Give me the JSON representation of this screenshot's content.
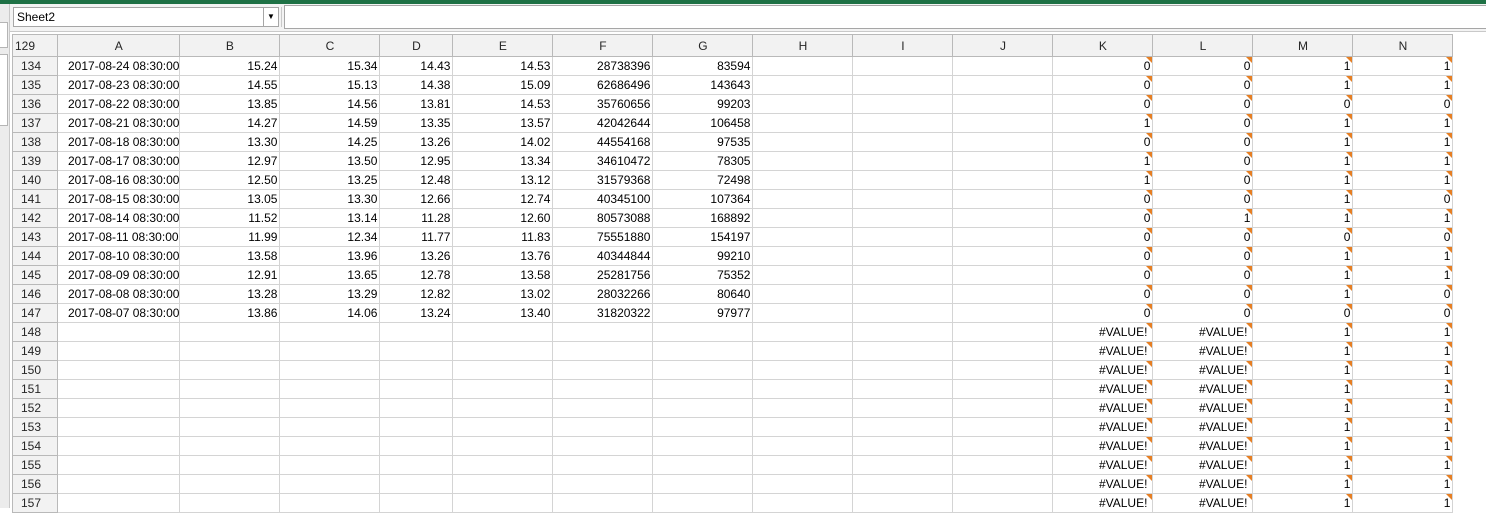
{
  "name_box": {
    "value": "Sheet2"
  },
  "formula_bar": {
    "value": ""
  },
  "corner_label": "129",
  "columns": [
    "A",
    "B",
    "C",
    "D",
    "E",
    "F",
    "G",
    "H",
    "I",
    "J",
    "K",
    "L",
    "M",
    "N"
  ],
  "rows": [
    {
      "num": "134",
      "A": "2017-08-24  08:30:00",
      "B": "15.24",
      "C": "15.34",
      "D": "14.43",
      "E": "14.53",
      "F": "28738396",
      "G": "83594",
      "K": "0",
      "L": "0",
      "M": "1",
      "N": "1"
    },
    {
      "num": "135",
      "A": "2017-08-23  08:30:00",
      "B": "14.55",
      "C": "15.13",
      "D": "14.38",
      "E": "15.09",
      "F": "62686496",
      "G": "143643",
      "K": "0",
      "L": "0",
      "M": "1",
      "N": "1"
    },
    {
      "num": "136",
      "A": "2017-08-22  08:30:00",
      "B": "13.85",
      "C": "14.56",
      "D": "13.81",
      "E": "14.53",
      "F": "35760656",
      "G": "99203",
      "K": "0",
      "L": "0",
      "M": "0",
      "N": "0"
    },
    {
      "num": "137",
      "A": "2017-08-21  08:30:00",
      "B": "14.27",
      "C": "14.59",
      "D": "13.35",
      "E": "13.57",
      "F": "42042644",
      "G": "106458",
      "K": "1",
      "L": "0",
      "M": "1",
      "N": "1"
    },
    {
      "num": "138",
      "A": "2017-08-18  08:30:00",
      "B": "13.30",
      "C": "14.25",
      "D": "13.26",
      "E": "14.02",
      "F": "44554168",
      "G": "97535",
      "K": "0",
      "L": "0",
      "M": "1",
      "N": "1"
    },
    {
      "num": "139",
      "A": "2017-08-17  08:30:00",
      "B": "12.97",
      "C": "13.50",
      "D": "12.95",
      "E": "13.34",
      "F": "34610472",
      "G": "78305",
      "K": "1",
      "L": "0",
      "M": "1",
      "N": "1"
    },
    {
      "num": "140",
      "A": "2017-08-16  08:30:00",
      "B": "12.50",
      "C": "13.25",
      "D": "12.48",
      "E": "13.12",
      "F": "31579368",
      "G": "72498",
      "K": "1",
      "L": "0",
      "M": "1",
      "N": "1"
    },
    {
      "num": "141",
      "A": "2017-08-15  08:30:00",
      "B": "13.05",
      "C": "13.30",
      "D": "12.66",
      "E": "12.74",
      "F": "40345100",
      "G": "107364",
      "K": "0",
      "L": "0",
      "M": "1",
      "N": "0"
    },
    {
      "num": "142",
      "A": "2017-08-14  08:30:00",
      "B": "11.52",
      "C": "13.14",
      "D": "11.28",
      "E": "12.60",
      "F": "80573088",
      "G": "168892",
      "K": "0",
      "L": "1",
      "M": "1",
      "N": "1"
    },
    {
      "num": "143",
      "A": "2017-08-11  08:30:00",
      "B": "11.99",
      "C": "12.34",
      "D": "11.77",
      "E": "11.83",
      "F": "75551880",
      "G": "154197",
      "K": "0",
      "L": "0",
      "M": "0",
      "N": "0"
    },
    {
      "num": "144",
      "A": "2017-08-10  08:30:00",
      "B": "13.58",
      "C": "13.96",
      "D": "13.26",
      "E": "13.76",
      "F": "40344844",
      "G": "99210",
      "K": "0",
      "L": "0",
      "M": "1",
      "N": "1"
    },
    {
      "num": "145",
      "A": "2017-08-09  08:30:00",
      "B": "12.91",
      "C": "13.65",
      "D": "12.78",
      "E": "13.58",
      "F": "25281756",
      "G": "75352",
      "K": "0",
      "L": "0",
      "M": "1",
      "N": "1"
    },
    {
      "num": "146",
      "A": "2017-08-08  08:30:00",
      "B": "13.28",
      "C": "13.29",
      "D": "12.82",
      "E": "13.02",
      "F": "28032266",
      "G": "80640",
      "K": "0",
      "L": "0",
      "M": "1",
      "N": "0"
    },
    {
      "num": "147",
      "A": "2017-08-07  08:30:00",
      "B": "13.86",
      "C": "14.06",
      "D": "13.24",
      "E": "13.40",
      "F": "31820322",
      "G": "97977",
      "K": "0",
      "L": "0",
      "M": "0",
      "N": "0"
    },
    {
      "num": "148",
      "K": "#VALUE!",
      "L": "#VALUE!",
      "M": "1",
      "N": "1"
    },
    {
      "num": "149",
      "K": "#VALUE!",
      "L": "#VALUE!",
      "M": "1",
      "N": "1"
    },
    {
      "num": "150",
      "K": "#VALUE!",
      "L": "#VALUE!",
      "M": "1",
      "N": "1"
    },
    {
      "num": "151",
      "K": "#VALUE!",
      "L": "#VALUE!",
      "M": "1",
      "N": "1"
    },
    {
      "num": "152",
      "K": "#VALUE!",
      "L": "#VALUE!",
      "M": "1",
      "N": "1"
    },
    {
      "num": "153",
      "K": "#VALUE!",
      "L": "#VALUE!",
      "M": "1",
      "N": "1"
    },
    {
      "num": "154",
      "K": "#VALUE!",
      "L": "#VALUE!",
      "M": "1",
      "N": "1"
    },
    {
      "num": "155",
      "K": "#VALUE!",
      "L": "#VALUE!",
      "M": "1",
      "N": "1"
    },
    {
      "num": "156",
      "K": "#VALUE!",
      "L": "#VALUE!",
      "M": "1",
      "N": "1"
    },
    {
      "num": "157",
      "K": "#VALUE!",
      "L": "#VALUE!",
      "M": "1",
      "N": "1"
    }
  ],
  "colors": {
    "accent": "#1e7145",
    "error_indicator": "#e67e22"
  }
}
